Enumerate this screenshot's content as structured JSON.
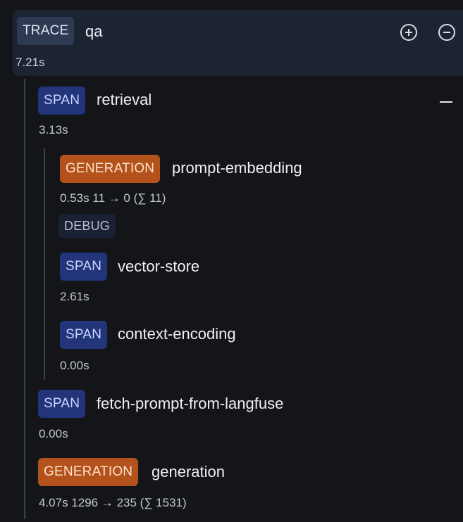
{
  "trace": {
    "badge": "TRACE",
    "name": "qa",
    "duration": "7.21s",
    "expand_all_icon": "plus-circle-icon",
    "collapse_all_icon": "minus-circle-icon"
  },
  "nodes": [
    {
      "badge": "SPAN",
      "name": "retrieval",
      "meta": "3.13s",
      "collapse_icon": "minus-icon"
    },
    {
      "badge": "GENERATION",
      "name": "prompt-embedding",
      "meta": "0.53s  11 → 0 (∑ 11)",
      "level": "DEBUG"
    },
    {
      "badge": "SPAN",
      "name": "vector-store",
      "meta": "2.61s"
    },
    {
      "badge": "SPAN",
      "name": "context-encoding",
      "meta": "0.00s"
    },
    {
      "badge": "SPAN",
      "name": "fetch-prompt-from-langfuse",
      "meta": "0.00s"
    },
    {
      "badge": "GENERATION",
      "name": "generation",
      "meta": "4.07s  1296 → 235 (∑ 1531)"
    }
  ],
  "colors": {
    "span_badge": "#22347a",
    "generation_badge": "#b4521b",
    "trace_badge": "#2e3a52",
    "header_bg": "#1c2433"
  }
}
